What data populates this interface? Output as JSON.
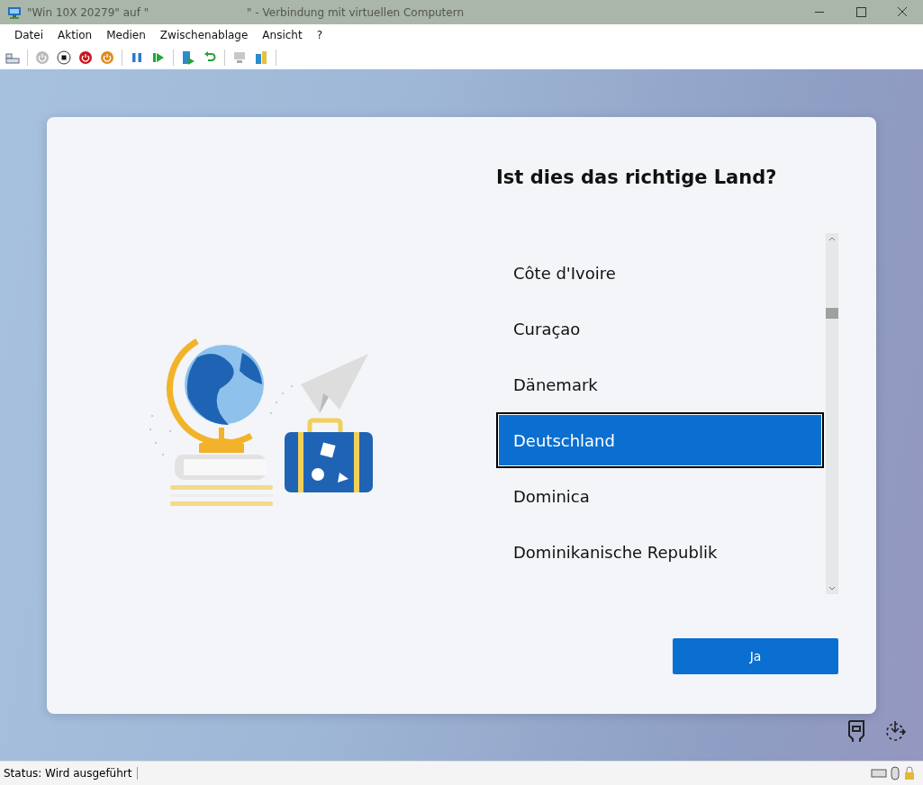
{
  "window": {
    "title_start": "\"Win 10X 20279\" auf \"",
    "title_end": "\" - Verbindung mit virtuellen Computern"
  },
  "menu": [
    "Datei",
    "Aktion",
    "Medien",
    "Zwischenablage",
    "Ansicht",
    "?"
  ],
  "setup": {
    "heading": "Ist dies das richtige Land?",
    "countries": [
      {
        "label": "Côte d'Ivoire",
        "selected": false
      },
      {
        "label": "Curaçao",
        "selected": false
      },
      {
        "label": "Dänemark",
        "selected": false
      },
      {
        "label": "Deutschland",
        "selected": true
      },
      {
        "label": "Dominica",
        "selected": false
      },
      {
        "label": "Dominikanische Republik",
        "selected": false
      }
    ],
    "button": "Ja"
  },
  "status_bar": {
    "text": "Status: Wird ausgeführt"
  }
}
